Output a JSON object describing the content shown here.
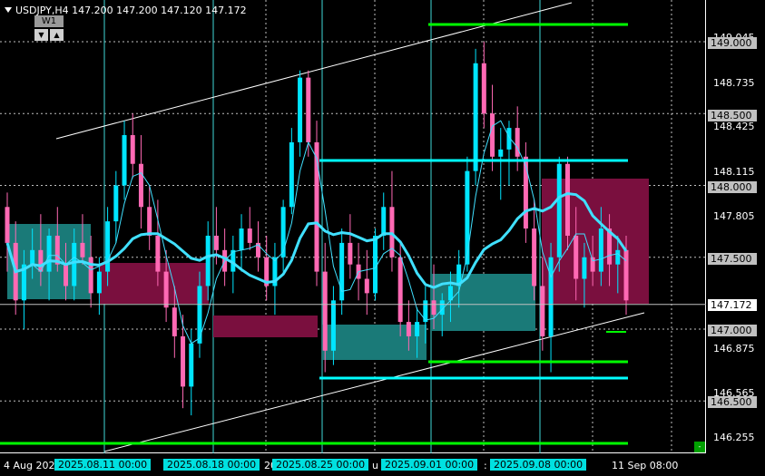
{
  "header": {
    "symbol_text": "USDJPY,H4  147.200 147.200 147.120 147.172",
    "timeframe_label": "W1",
    "down_glyph": "▼",
    "up_glyph": "▲"
  },
  "price_scale": {
    "ticks": [
      "149.045",
      "148.735",
      "148.425",
      "148.115",
      "147.805",
      "146.875",
      "146.565",
      "146.255"
    ],
    "highlight_levels": [
      "149.000",
      "148.500",
      "148.000",
      "147.500",
      "147.000",
      "146.500"
    ],
    "current_price": "147.172"
  },
  "time_axis": {
    "plain_labels": [
      "4 Aug 202",
      "20",
      "20",
      "u",
      ":",
      "11 Sep 08:00"
    ],
    "highlight_labels": [
      "2025.08.11 00:00",
      "2025.08.18 00:00",
      "2025.08.25 00:00",
      "2025.09.01 00:00",
      "2025.09.08 00:00"
    ]
  },
  "colors": {
    "background": "#000000",
    "bull_candle": "#00e5ff",
    "bear_candle": "#ff69b4",
    "ma_color": "#40e0ff",
    "zone_teal": "#1a7a78",
    "zone_maroon": "#7a0f3e",
    "level_green": "#00ff00",
    "level_cyan": "#00ffff",
    "grid": "#c0c0c0"
  },
  "icons": {
    "menu_triangle": "triangle-down-icon",
    "corner": "green-square-icon"
  },
  "chart_data": {
    "type": "candlestick",
    "symbol": "USDJPY",
    "timeframe": "H4",
    "ylim": [
      146.2,
      149.35
    ],
    "ticks": [
      149.045,
      148.735,
      148.425,
      148.115,
      147.805,
      146.875,
      146.565,
      146.255
    ],
    "levels": [
      149.0,
      148.5,
      148.0,
      147.5,
      147.0,
      146.5
    ],
    "current": 147.172,
    "ohlc": [
      [
        147.85,
        147.95,
        147.4,
        147.6
      ],
      [
        147.6,
        147.75,
        147.1,
        147.2
      ],
      [
        147.2,
        147.55,
        147.0,
        147.45
      ],
      [
        147.45,
        147.7,
        147.35,
        147.55
      ],
      [
        147.55,
        147.8,
        147.3,
        147.4
      ],
      [
        147.4,
        147.7,
        147.2,
        147.65
      ],
      [
        147.65,
        147.85,
        147.4,
        147.45
      ],
      [
        147.45,
        147.6,
        147.2,
        147.3
      ],
      [
        147.3,
        147.7,
        147.2,
        147.6
      ],
      [
        147.6,
        147.8,
        147.45,
        147.5
      ],
      [
        147.5,
        147.65,
        147.15,
        147.25
      ],
      [
        147.25,
        147.5,
        147.1,
        147.4
      ],
      [
        147.4,
        147.85,
        147.3,
        147.75
      ],
      [
        147.75,
        148.1,
        147.6,
        148.0
      ],
      [
        148.0,
        148.45,
        147.9,
        148.35
      ],
      [
        148.35,
        148.5,
        148.05,
        148.15
      ],
      [
        148.15,
        148.35,
        147.7,
        147.85
      ],
      [
        147.85,
        148.0,
        147.55,
        147.65
      ],
      [
        147.65,
        147.9,
        147.3,
        147.4
      ],
      [
        147.4,
        147.55,
        147.05,
        147.15
      ],
      [
        147.15,
        147.3,
        146.8,
        146.95
      ],
      [
        146.95,
        147.1,
        146.45,
        146.6
      ],
      [
        146.6,
        147.0,
        146.4,
        146.9
      ],
      [
        146.9,
        147.4,
        146.8,
        147.3
      ],
      [
        147.3,
        147.75,
        147.2,
        147.65
      ],
      [
        147.65,
        147.85,
        147.45,
        147.55
      ],
      [
        147.55,
        147.7,
        147.3,
        147.4
      ],
      [
        147.4,
        147.65,
        147.25,
        147.55
      ],
      [
        147.55,
        147.8,
        147.4,
        147.7
      ],
      [
        147.7,
        147.85,
        147.55,
        147.6
      ],
      [
        147.6,
        147.75,
        147.4,
        147.5
      ],
      [
        147.5,
        147.65,
        147.2,
        147.3
      ],
      [
        147.3,
        147.6,
        147.1,
        147.5
      ],
      [
        147.5,
        147.9,
        147.4,
        147.85
      ],
      [
        147.85,
        148.4,
        147.8,
        148.3
      ],
      [
        148.3,
        148.8,
        148.2,
        148.75
      ],
      [
        148.75,
        148.8,
        148.2,
        148.3
      ],
      [
        148.3,
        148.45,
        147.3,
        147.4
      ],
      [
        147.4,
        147.6,
        146.7,
        146.85
      ],
      [
        146.85,
        147.3,
        146.75,
        147.2
      ],
      [
        147.2,
        147.7,
        147.1,
        147.6
      ],
      [
        147.6,
        147.8,
        147.35,
        147.45
      ],
      [
        147.45,
        147.6,
        147.2,
        147.35
      ],
      [
        147.35,
        147.55,
        147.1,
        147.25
      ],
      [
        147.25,
        147.7,
        147.2,
        147.65
      ],
      [
        147.65,
        147.95,
        147.55,
        147.85
      ],
      [
        147.85,
        148.1,
        147.4,
        147.5
      ],
      [
        147.5,
        147.6,
        146.95,
        147.05
      ],
      [
        147.05,
        147.2,
        146.85,
        146.95
      ],
      [
        146.95,
        147.15,
        146.8,
        147.05
      ],
      [
        147.05,
        147.3,
        146.9,
        147.2
      ],
      [
        147.2,
        147.45,
        147.0,
        147.1
      ],
      [
        147.1,
        147.25,
        146.95,
        147.2
      ],
      [
        147.2,
        147.4,
        147.05,
        147.3
      ],
      [
        147.3,
        147.55,
        147.15,
        147.45
      ],
      [
        147.45,
        148.2,
        147.4,
        148.1
      ],
      [
        148.1,
        148.95,
        148.0,
        148.85
      ],
      [
        148.85,
        149.0,
        148.4,
        148.5
      ],
      [
        148.5,
        148.7,
        148.1,
        148.2
      ],
      [
        148.2,
        148.4,
        147.9,
        148.25
      ],
      [
        148.25,
        148.45,
        148.0,
        148.4
      ],
      [
        148.4,
        148.55,
        148.1,
        148.2
      ],
      [
        148.2,
        148.3,
        147.6,
        147.7
      ],
      [
        147.7,
        147.9,
        147.2,
        147.3
      ],
      [
        147.3,
        147.5,
        146.85,
        146.95
      ],
      [
        146.95,
        147.6,
        146.7,
        147.5
      ],
      [
        147.5,
        148.2,
        147.4,
        148.15
      ],
      [
        148.15,
        148.2,
        147.55,
        147.65
      ],
      [
        147.65,
        147.85,
        147.2,
        147.35
      ],
      [
        147.35,
        147.6,
        147.15,
        147.5
      ],
      [
        147.5,
        147.65,
        147.3,
        147.4
      ],
      [
        147.4,
        147.85,
        147.3,
        147.7
      ],
      [
        147.7,
        147.8,
        147.3,
        147.45
      ],
      [
        147.45,
        147.65,
        147.25,
        147.55
      ],
      [
        147.55,
        147.65,
        147.1,
        147.2
      ]
    ]
  }
}
